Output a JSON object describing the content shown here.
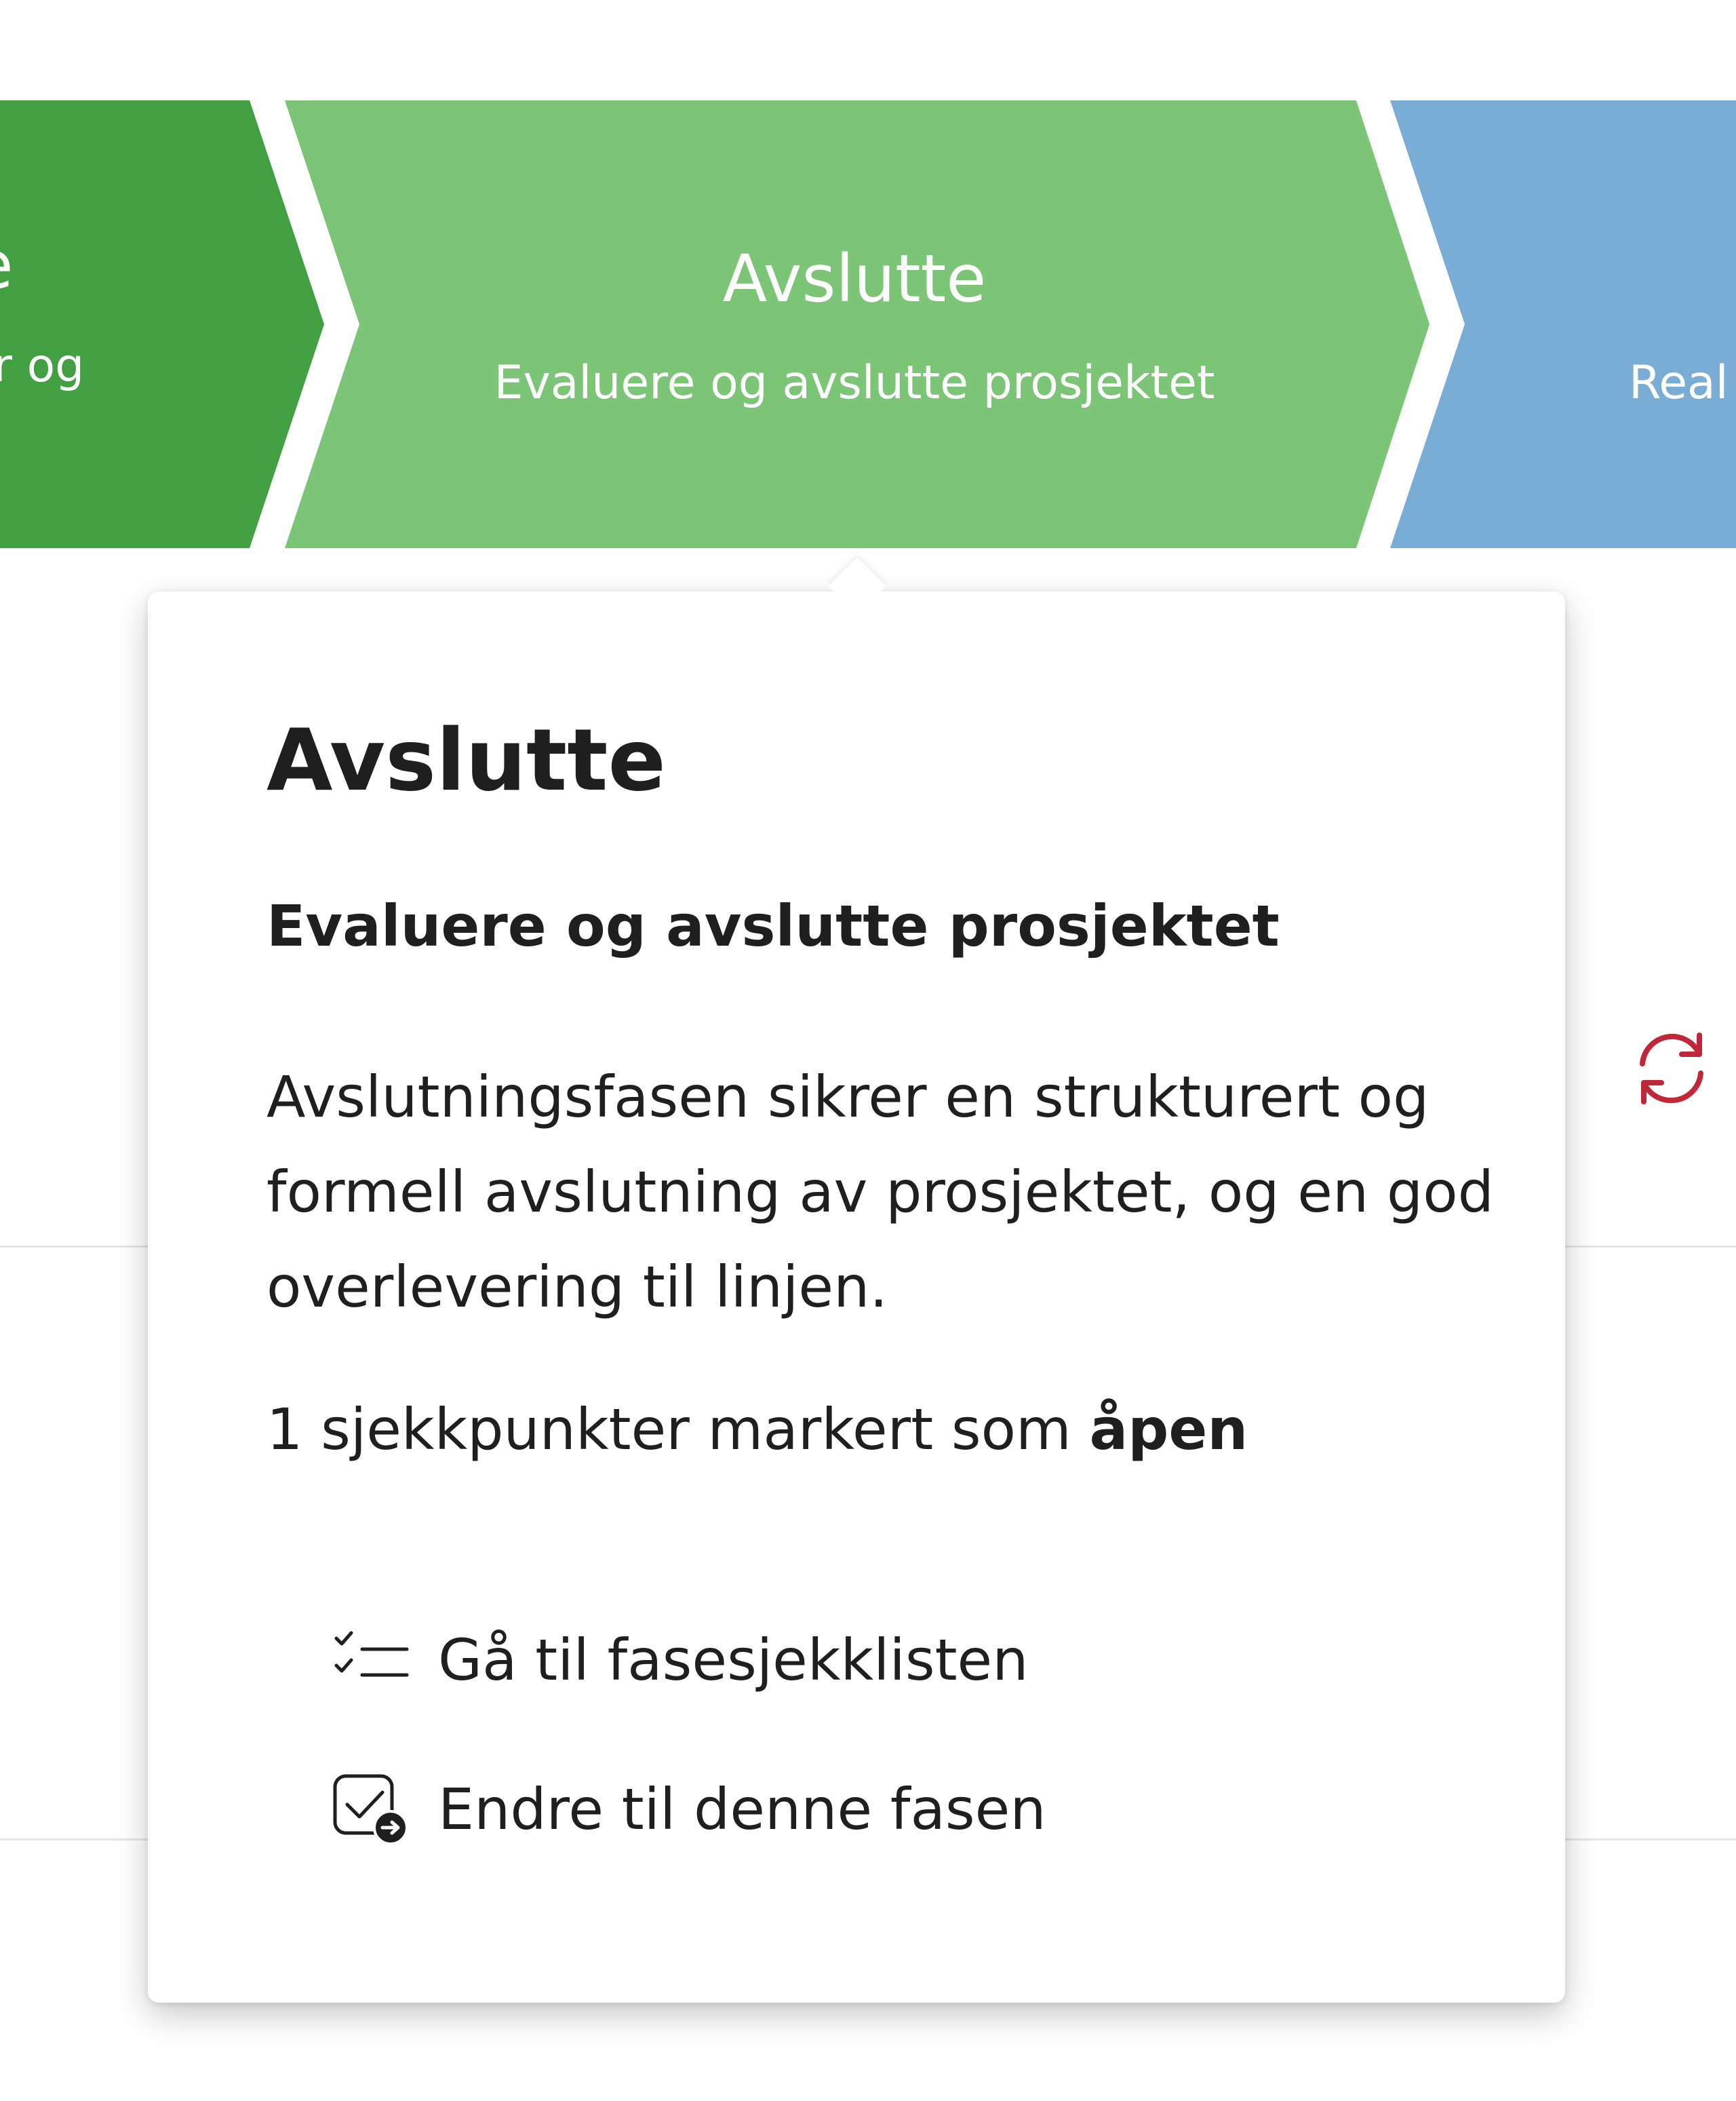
{
  "phases": [
    {
      "title": "",
      "subtitle": "r og",
      "color": "#42a042"
    },
    {
      "title": "Avslutte",
      "subtitle": "Evaluere og avslutte prosjektet",
      "color": "#7cc576"
    },
    {
      "title": "",
      "subtitle": "Real",
      "color": "#7aadd6"
    }
  ],
  "callout": {
    "title": "Avslutte",
    "subtitle": "Evaluere og avslutte prosjektet",
    "description": "Avslutningsfasen sikrer en strukturert og formell avslutning av prosjektet, og en god overlevering til linjen.",
    "checkpoints_prefix": "1 sjekkpunkter markert som",
    "checkpoints_status": "åpen",
    "actions": [
      {
        "label": "Gå til fasesjekklisten",
        "icon": "checklist-icon"
      },
      {
        "label": "Endre til denne fasen",
        "icon": "change-phase-icon"
      }
    ]
  },
  "icons": {
    "refresh": "refresh-icon"
  },
  "colors": {
    "refresh": "#c0283a",
    "text": "#1f1f1f"
  }
}
